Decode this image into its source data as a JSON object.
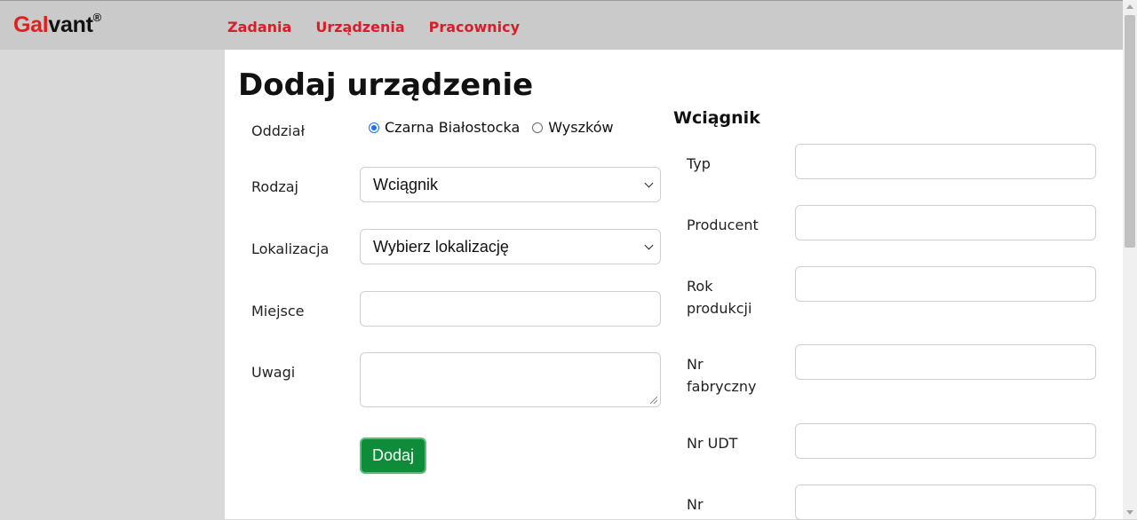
{
  "brand": {
    "part1": "Gal",
    "part2": "vant",
    "reg": "®"
  },
  "nav": {
    "items": [
      "Zadania",
      "Urządzenia",
      "Pracownicy"
    ]
  },
  "page": {
    "title": "Dodaj urządzenie"
  },
  "form": {
    "oddzial": {
      "label": "Oddział",
      "options": [
        "Czarna Białostocka",
        "Wyszków"
      ],
      "selected": "Czarna Białostocka"
    },
    "rodzaj": {
      "label": "Rodzaj",
      "value": "Wciągnik"
    },
    "lokalizacja": {
      "label": "Lokalizacja",
      "value": "Wybierz lokalizację"
    },
    "miejsce": {
      "label": "Miejsce",
      "value": ""
    },
    "uwagi": {
      "label": "Uwagi",
      "value": ""
    },
    "submit_label": "Dodaj"
  },
  "details": {
    "title": "Wciągnik",
    "fields": [
      {
        "label": "Typ",
        "value": ""
      },
      {
        "label": "Producent",
        "value": ""
      },
      {
        "label": "Rok produkcji",
        "value": ""
      },
      {
        "label": "Nr fabryczny",
        "value": ""
      },
      {
        "label": "Nr UDT",
        "value": ""
      },
      {
        "label": "Nr",
        "value": ""
      }
    ]
  },
  "colors": {
    "brand_red": "#e01f1f",
    "nav_red": "#d81e2a",
    "button_green": "#0e8c3a",
    "topbar": "#cacaca",
    "background": "#d9d9d9"
  }
}
